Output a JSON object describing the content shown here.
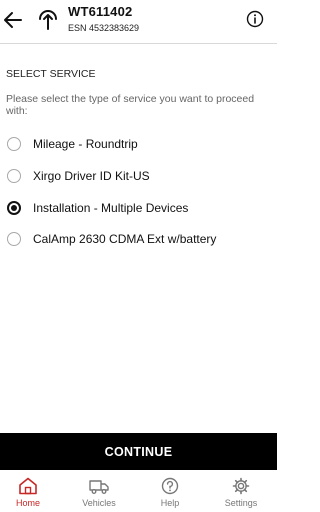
{
  "header": {
    "device_id": "WT611402",
    "esn": "ESN 4532383629",
    "icons": {
      "back": "arrow-left-icon",
      "device": "signal-antenna-icon",
      "info": "info-circle-icon"
    }
  },
  "content": {
    "section_title": "SELECT SERVICE",
    "instructions": "Please select the type of service you want to proceed with:",
    "options": [
      {
        "label": "Mileage - Roundtrip",
        "selected": false
      },
      {
        "label": "Xirgo Driver ID Kit-US",
        "selected": false
      },
      {
        "label": "Installation - Multiple Devices",
        "selected": true
      },
      {
        "label": "CalAmp 2630 CDMA Ext w/battery",
        "selected": false
      }
    ]
  },
  "continue_label": "CONTINUE",
  "nav": {
    "items": [
      {
        "label": "Home",
        "icon": "home-icon",
        "active": true
      },
      {
        "label": "Vehicles",
        "icon": "truck-icon",
        "active": false
      },
      {
        "label": "Help",
        "icon": "help-circle-icon",
        "active": false
      },
      {
        "label": "Settings",
        "icon": "gear-icon",
        "active": false
      }
    ]
  },
  "colors": {
    "accent": "#c62828",
    "button_bg": "#000000",
    "muted_text": "#666666"
  }
}
